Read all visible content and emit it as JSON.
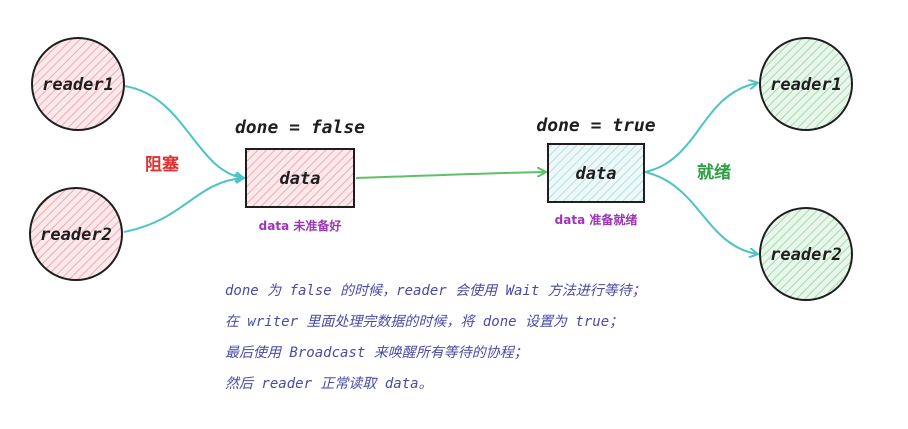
{
  "left": {
    "reader1": "reader1",
    "reader2": "reader2",
    "blocked": "阻塞",
    "state_label": "done = false",
    "data_box": "data",
    "sub_label": "data 未准备好"
  },
  "right": {
    "reader1": "reader1",
    "reader2": "reader2",
    "ready": "就绪",
    "state_label": "done = true",
    "data_box": "data",
    "sub_label": "data 准备就绪"
  },
  "notes": [
    "done 为 false 的时候，reader 会使用 Wait 方法进行等待；",
    "在 writer 里面处理完数据的时候，将 done 设置为 true；",
    "最后使用 Broadcast 来唤醒所有等待的协程；",
    "然后 reader 正常读取 data。"
  ],
  "colors": {
    "red_fill": "#f7d9dc",
    "red_stroke": "#1e1e1e",
    "green_fill": "#d9efdc",
    "teal_fill": "#dff1f1",
    "teal_arrow": "#4fc3c3",
    "green_arrow": "#5fbf6a",
    "red_text": "#e03131",
    "green_text": "#2f9e44",
    "purple_text": "#9c36b5",
    "note_text": "#4a4aa8"
  }
}
